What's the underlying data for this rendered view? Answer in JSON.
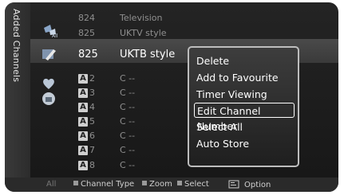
{
  "side_tab": "Added Channels",
  "channels_top": [
    {
      "number": "824",
      "name": "Television"
    },
    {
      "number": "825",
      "name": "UKTV style"
    }
  ],
  "selected": {
    "number": "825",
    "name": "UKTB style"
  },
  "analog": [
    {
      "badge": "A",
      "number": "2",
      "name": "C --"
    },
    {
      "badge": "A",
      "number": "3",
      "name": "C --"
    },
    {
      "badge": "A",
      "number": "4",
      "name": "C --"
    },
    {
      "badge": "A",
      "number": "5",
      "name": "C --"
    },
    {
      "badge": "A",
      "number": "6",
      "name": "C --"
    },
    {
      "badge": "A",
      "number": "7",
      "name": "C --"
    },
    {
      "badge": "A",
      "number": "8",
      "name": "C --"
    }
  ],
  "menu": [
    "Delete",
    "Add to Favourite",
    "Timer Viewing",
    "Edit Channel Number",
    "Select All",
    "Auto Store"
  ],
  "menu_active_index": 3,
  "footer": {
    "all": "All",
    "channel_type": "Channel Type",
    "zoom": "Zoom",
    "select": "Select",
    "option": "Option"
  },
  "icons": [
    "channel-list-icon",
    "edit-icon",
    "heart-icon",
    "lock-icon",
    "remote-option-icon"
  ]
}
